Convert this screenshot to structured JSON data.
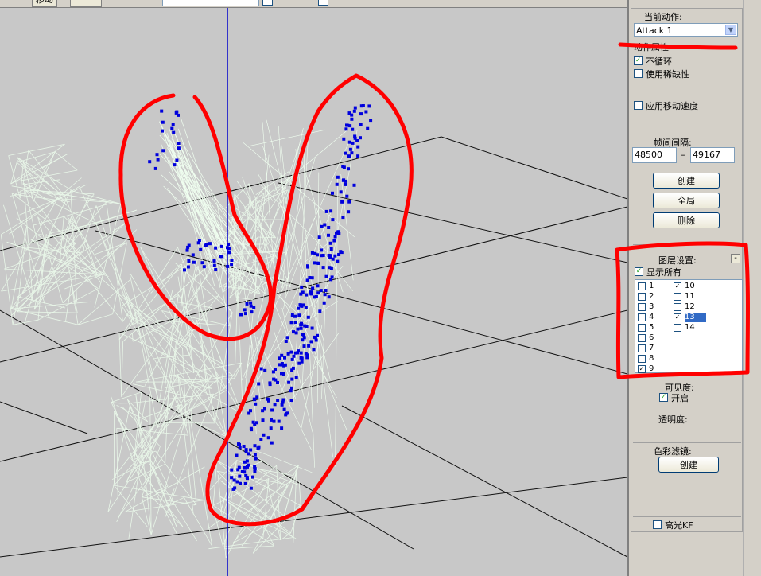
{
  "topbar": {
    "tab_label": "移动"
  },
  "panel": {
    "current_action_label": "当前动作:",
    "current_action_value": "Attack 1",
    "action_props_label": "动作属性",
    "no_loop_label": "不循环",
    "use_sparse_label": "使用稀缺性",
    "apply_move_speed_label": "应用移动速度",
    "frame_interval_label": "帧间间隔:",
    "frame_start": "48500",
    "frame_sep": "–",
    "frame_end": "49167",
    "create_label": "创建",
    "global_label": "全局",
    "delete_label": "删除",
    "layer_settings_label": "图层设置:",
    "show_all_label": "显示所有",
    "visibility_label": "可见度:",
    "enable_label": "开启",
    "opacity_label": "透明度:",
    "color_filter_label": "色彩滤镜:",
    "color_filter_create_label": "创建",
    "highlight_kf_label": "高光KF"
  },
  "layers": [
    {
      "label": "1",
      "checked": false
    },
    {
      "label": "2",
      "checked": false
    },
    {
      "label": "3",
      "checked": false
    },
    {
      "label": "4",
      "checked": false
    },
    {
      "label": "5",
      "checked": false
    },
    {
      "label": "6",
      "checked": false
    },
    {
      "label": "7",
      "checked": false
    },
    {
      "label": "8",
      "checked": false
    },
    {
      "label": "9",
      "checked": true
    },
    {
      "label": "10",
      "checked": true
    },
    {
      "label": "11",
      "checked": false
    },
    {
      "label": "12",
      "checked": false
    },
    {
      "label": "13",
      "checked": true,
      "selected": true
    },
    {
      "label": "14",
      "checked": false
    }
  ],
  "colors": {
    "viewport_bg": "#c8c8c8",
    "annotation": "#ff0000",
    "points": "#0000dd",
    "mesh": "#e8f6e8",
    "axis": "#0000cc"
  }
}
